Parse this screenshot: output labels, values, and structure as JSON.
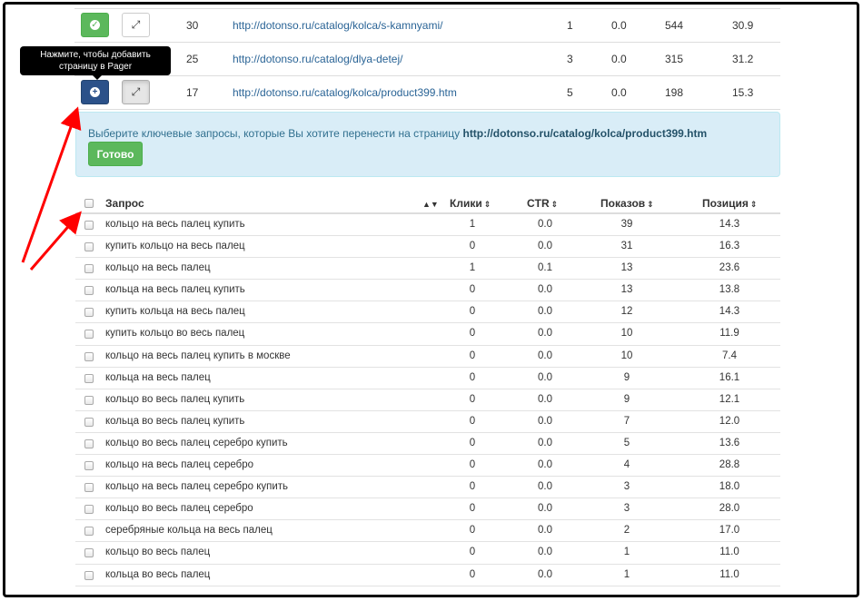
{
  "url_rows": [
    {
      "btn": "green",
      "count": "30",
      "url": "http://dotonso.ru/catalog/kolca/s-kamnyami/",
      "c1": "1",
      "c2": "0.0",
      "c3": "544",
      "c4": "30.9"
    },
    {
      "btn": "none",
      "count": "25",
      "url": "http://dotonso.ru/catalog/dlya-detej/",
      "c1": "3",
      "c2": "0.0",
      "c3": "315",
      "c4": "31.2"
    },
    {
      "btn": "navy",
      "count": "17",
      "url": "http://dotonso.ru/catalog/kolca/product399.htm",
      "c1": "5",
      "c2": "0.0",
      "c3": "198",
      "c4": "15.3"
    }
  ],
  "tooltip": "Нажмите, чтобы добавить страницу в Pager",
  "alert": {
    "message": "Выберите ключевые запросы, которые Вы хотите перенести на страницу",
    "url": "http://dotonso.ru/catalog/kolca/product399.htm",
    "done_label": "Готово"
  },
  "keywords": {
    "headers": {
      "query": "Запрос",
      "clicks": "Клики",
      "ctr": "CTR",
      "impressions": "Показов",
      "position": "Позиция"
    },
    "rows": [
      {
        "q": "кольцо на весь палец купить",
        "clicks": "1",
        "ctr": "0.0",
        "imp": "39",
        "pos": "14.3"
      },
      {
        "q": "купить кольцо на весь палец",
        "clicks": "0",
        "ctr": "0.0",
        "imp": "31",
        "pos": "16.3"
      },
      {
        "q": "кольцо на весь палец",
        "clicks": "1",
        "ctr": "0.1",
        "imp": "13",
        "pos": "23.6"
      },
      {
        "q": "кольца на весь палец купить",
        "clicks": "0",
        "ctr": "0.0",
        "imp": "13",
        "pos": "13.8"
      },
      {
        "q": "купить кольца на весь палец",
        "clicks": "0",
        "ctr": "0.0",
        "imp": "12",
        "pos": "14.3"
      },
      {
        "q": "купить кольцо во весь палец",
        "clicks": "0",
        "ctr": "0.0",
        "imp": "10",
        "pos": "11.9"
      },
      {
        "q": "кольцо на весь палец купить в москве",
        "clicks": "0",
        "ctr": "0.0",
        "imp": "10",
        "pos": "7.4"
      },
      {
        "q": "кольца на весь палец",
        "clicks": "0",
        "ctr": "0.0",
        "imp": "9",
        "pos": "16.1"
      },
      {
        "q": "кольцо во весь палец купить",
        "clicks": "0",
        "ctr": "0.0",
        "imp": "9",
        "pos": "12.1"
      },
      {
        "q": "кольца во весь палец купить",
        "clicks": "0",
        "ctr": "0.0",
        "imp": "7",
        "pos": "12.0"
      },
      {
        "q": "кольцо во весь палец серебро купить",
        "clicks": "0",
        "ctr": "0.0",
        "imp": "5",
        "pos": "13.6"
      },
      {
        "q": "кольцо на весь палец серебро",
        "clicks": "0",
        "ctr": "0.0",
        "imp": "4",
        "pos": "28.8"
      },
      {
        "q": "кольцо на весь палец серебро купить",
        "clicks": "0",
        "ctr": "0.0",
        "imp": "3",
        "pos": "18.0"
      },
      {
        "q": "кольцо во весь палец серебро",
        "clicks": "0",
        "ctr": "0.0",
        "imp": "3",
        "pos": "28.0"
      },
      {
        "q": "серебряные кольца на весь палец",
        "clicks": "0",
        "ctr": "0.0",
        "imp": "2",
        "pos": "17.0"
      },
      {
        "q": "кольцо во весь палец",
        "clicks": "0",
        "ctr": "0.0",
        "imp": "1",
        "pos": "11.0"
      },
      {
        "q": "кольца во весь палец",
        "clicks": "0",
        "ctr": "0.0",
        "imp": "1",
        "pos": "11.0"
      }
    ]
  },
  "colors": {
    "green": "#5cb85c",
    "navy": "#2b5189",
    "alert_bg": "#d9edf7",
    "arrow": "#ff0000"
  }
}
